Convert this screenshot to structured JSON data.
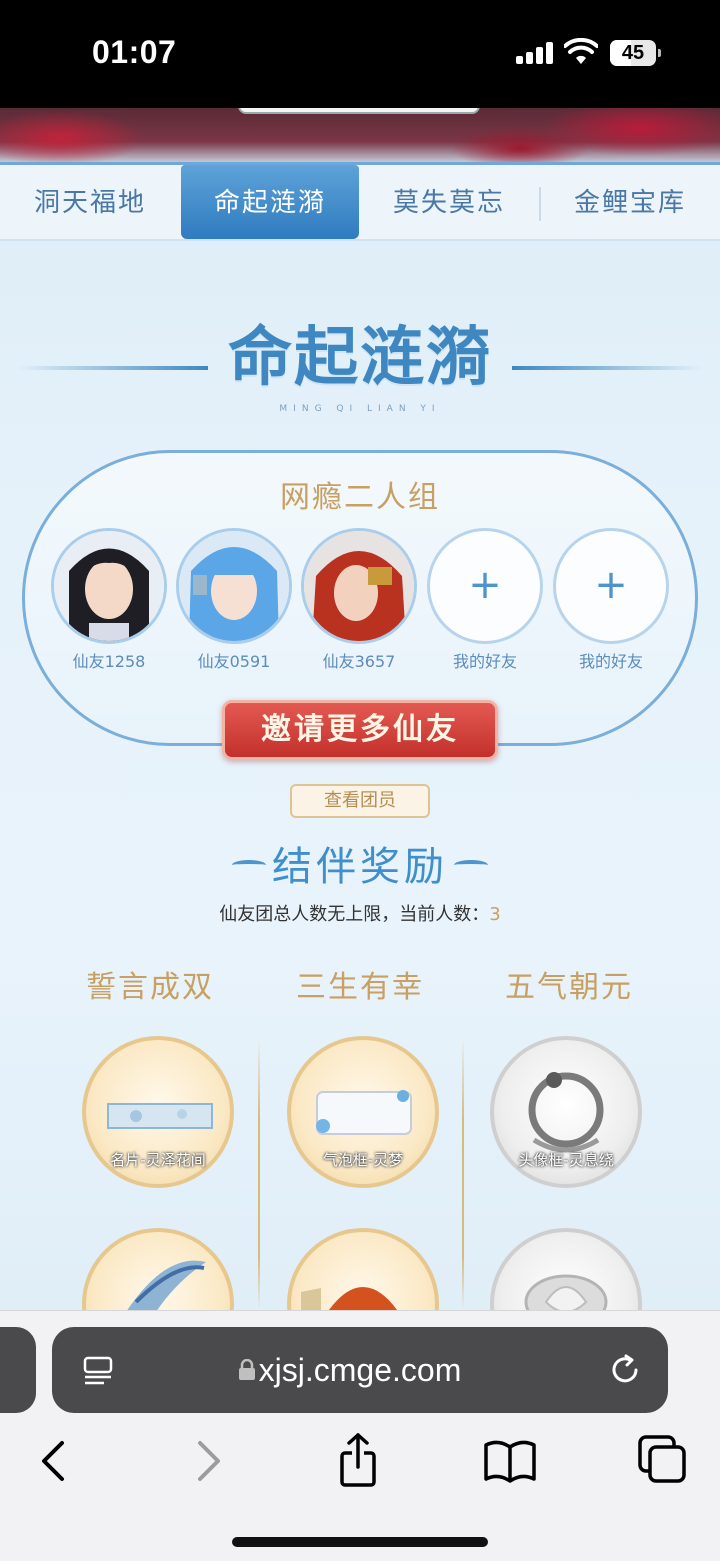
{
  "status_bar": {
    "time": "01:07",
    "battery": "45"
  },
  "tabs": [
    {
      "label": "洞天福地",
      "active": false
    },
    {
      "label": "命起涟漪",
      "active": true
    },
    {
      "label": "莫失莫忘",
      "active": false
    },
    {
      "label": "金鲤宝库",
      "active": false
    }
  ],
  "section": {
    "title": "命起涟漪",
    "subtitle": "MING QI LIAN YI"
  },
  "team": {
    "name": "网瘾二人组",
    "members": [
      {
        "name": "仙友1258",
        "type": "avatar",
        "hair": "#1e1e24"
      },
      {
        "name": "仙友0591",
        "type": "avatar",
        "hair": "#5aa6e6"
      },
      {
        "name": "仙友3657",
        "type": "avatar",
        "hair": "#b8321f"
      },
      {
        "name": "我的好友",
        "type": "add",
        "plus": "+"
      },
      {
        "name": "我的好友",
        "type": "add",
        "plus": "+"
      }
    ],
    "invite_label": "邀请更多仙友",
    "view_members_label": "查看团员"
  },
  "rewards": {
    "title": "结伴奖励",
    "count_text": "仙友团总人数无上限，当前人数：",
    "count_value": "3",
    "columns": [
      {
        "title": "誓言成双",
        "items": [
          {
            "label": "名片-灵泽花间",
            "style": "gold"
          },
          {
            "label": "",
            "style": "gold"
          }
        ]
      },
      {
        "title": "三生有幸",
        "items": [
          {
            "label": "气泡框-灵梦",
            "style": "gold"
          },
          {
            "label": "",
            "style": "gold"
          }
        ]
      },
      {
        "title": "五气朝元",
        "items": [
          {
            "label": "头像框-灵息绕",
            "style": "silver"
          },
          {
            "label": "",
            "style": "silver"
          }
        ]
      }
    ]
  },
  "browser": {
    "url": "xjsj.cmge.com"
  },
  "colors": {
    "accent_blue": "#3f87c0",
    "gold": "#c8a062",
    "invite_red": "#c3302c"
  }
}
